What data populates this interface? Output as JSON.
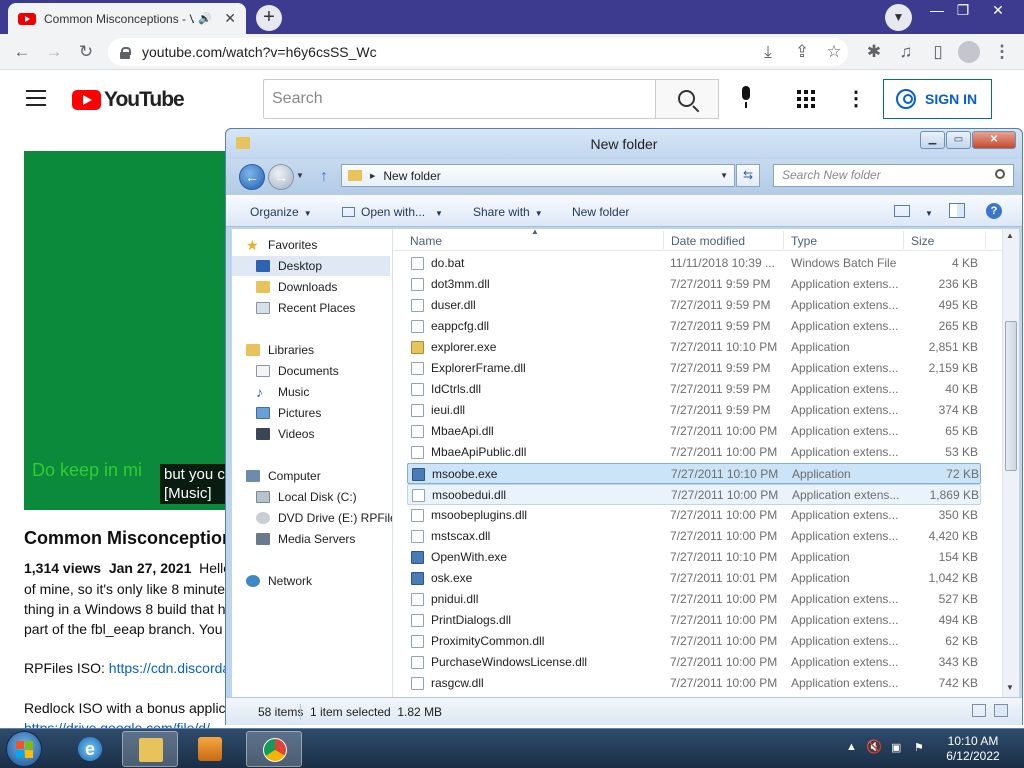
{
  "browser": {
    "tab_title": "Common Misconceptions - V",
    "url": "youtube.com/watch?v=h6y6csSS_Wc"
  },
  "youtube": {
    "logo_text": "YouTube",
    "search_placeholder": "Search",
    "sign_in": "SIGN IN",
    "caption_ghost": "Do keep in mi",
    "caption_line1": "but you c",
    "caption_line2": "[Music]",
    "video_title": "Common Misconceptions",
    "views": "1,314 views",
    "date": "Jan 27, 2021",
    "desc_line1_rest": "Hello",
    "desc_line2": "of mine, so it's only like 8 minutes",
    "desc_line3": "thing in a Windows 8 build that h",
    "desc_line4": "part of the fbl_eeap branch. You",
    "rpfiles_label": "RPFiles ISO: ",
    "rpfiles_link": "https://cdn.discorda",
    "redlock_line": "Redlock ISO with a bonus applic",
    "drive_link": "https://drive.google.com/file/d/"
  },
  "explorer": {
    "title": "New folder",
    "address_crumb": "New folder",
    "search_placeholder": "Search New folder",
    "commands": {
      "organize": "Organize",
      "open_with": "Open with...",
      "share_with": "Share with",
      "new_folder": "New folder"
    },
    "nav": {
      "favorites": "Favorites",
      "desktop": "Desktop",
      "downloads": "Downloads",
      "recent": "Recent Places",
      "libraries": "Libraries",
      "documents": "Documents",
      "music": "Music",
      "pictures": "Pictures",
      "videos": "Videos",
      "computer": "Computer",
      "local_disk": "Local Disk (C:)",
      "dvd": "DVD Drive (E:) RPFiles",
      "media": "Media Servers",
      "network": "Network"
    },
    "columns": {
      "name": "Name",
      "date": "Date modified",
      "type": "Type",
      "size": "Size"
    },
    "files": [
      {
        "name": "do.bat",
        "date": "11/11/2018 10:39 ...",
        "type": "Windows Batch File",
        "size": "4 KB"
      },
      {
        "name": "dot3mm.dll",
        "date": "7/27/2011 9:59 PM",
        "type": "Application extens...",
        "size": "236 KB"
      },
      {
        "name": "duser.dll",
        "date": "7/27/2011 9:59 PM",
        "type": "Application extens...",
        "size": "495 KB"
      },
      {
        "name": "eappcfg.dll",
        "date": "7/27/2011 9:59 PM",
        "type": "Application extens...",
        "size": "265 KB"
      },
      {
        "name": "explorer.exe",
        "date": "7/27/2011 10:10 PM",
        "type": "Application",
        "size": "2,851 KB"
      },
      {
        "name": "ExplorerFrame.dll",
        "date": "7/27/2011 9:59 PM",
        "type": "Application extens...",
        "size": "2,159 KB"
      },
      {
        "name": "IdCtrls.dll",
        "date": "7/27/2011 9:59 PM",
        "type": "Application extens...",
        "size": "40 KB"
      },
      {
        "name": "ieui.dll",
        "date": "7/27/2011 9:59 PM",
        "type": "Application extens...",
        "size": "374 KB"
      },
      {
        "name": "MbaeApi.dll",
        "date": "7/27/2011 10:00 PM",
        "type": "Application extens...",
        "size": "65 KB"
      },
      {
        "name": "MbaeApiPublic.dll",
        "date": "7/27/2011 10:00 PM",
        "type": "Application extens...",
        "size": "53 KB"
      },
      {
        "name": "msoobe.exe",
        "date": "7/27/2011 10:10 PM",
        "type": "Application",
        "size": "72 KB"
      },
      {
        "name": "msoobedui.dll",
        "date": "7/27/2011 10:00 PM",
        "type": "Application extens...",
        "size": "1,869 KB"
      },
      {
        "name": "msoobeplugins.dll",
        "date": "7/27/2011 10:00 PM",
        "type": "Application extens...",
        "size": "350 KB"
      },
      {
        "name": "mstscax.dll",
        "date": "7/27/2011 10:00 PM",
        "type": "Application extens...",
        "size": "4,420 KB"
      },
      {
        "name": "OpenWith.exe",
        "date": "7/27/2011 10:10 PM",
        "type": "Application",
        "size": "154 KB"
      },
      {
        "name": "osk.exe",
        "date": "7/27/2011 10:01 PM",
        "type": "Application",
        "size": "1,042 KB"
      },
      {
        "name": "pnidui.dll",
        "date": "7/27/2011 10:00 PM",
        "type": "Application extens...",
        "size": "527 KB"
      },
      {
        "name": "PrintDialogs.dll",
        "date": "7/27/2011 10:00 PM",
        "type": "Application extens...",
        "size": "494 KB"
      },
      {
        "name": "ProximityCommon.dll",
        "date": "7/27/2011 10:00 PM",
        "type": "Application extens...",
        "size": "62 KB"
      },
      {
        "name": "PurchaseWindowsLicense.dll",
        "date": "7/27/2011 10:00 PM",
        "type": "Application extens...",
        "size": "343 KB"
      },
      {
        "name": "rasgcw.dll",
        "date": "7/27/2011 10:00 PM",
        "type": "Application extens...",
        "size": "742 KB"
      }
    ],
    "status_items": "58 items",
    "status_selected": "1 item selected  1.82 MB"
  },
  "taskbar": {
    "time": "10:10 AM",
    "date": "6/12/2022"
  }
}
